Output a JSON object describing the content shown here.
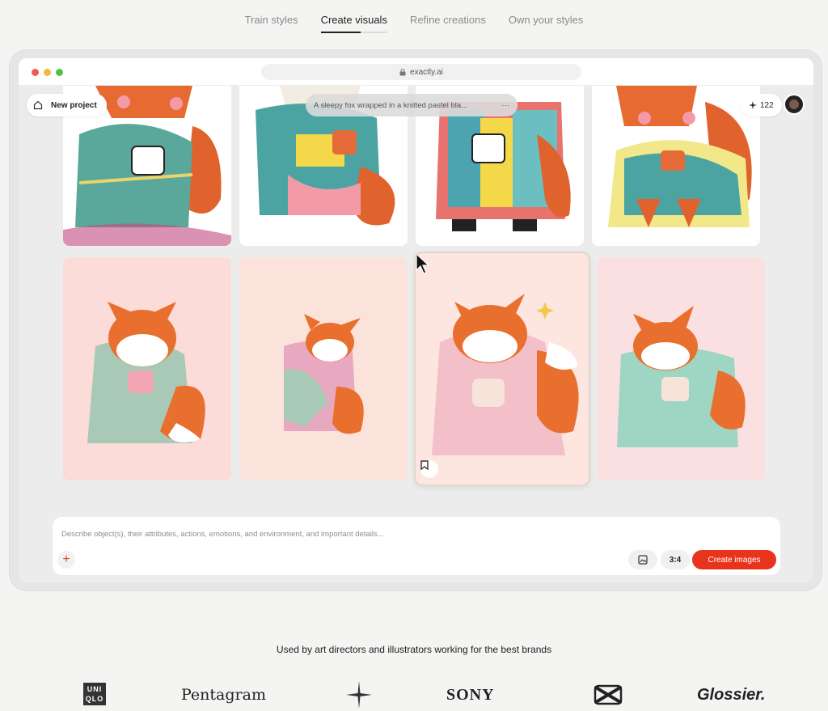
{
  "nav": {
    "tabs": [
      {
        "label": "Train styles"
      },
      {
        "label": "Create visuals",
        "active": true,
        "progress": 0.6
      },
      {
        "label": "Refine creations"
      },
      {
        "label": "Own your styles"
      }
    ]
  },
  "browser": {
    "url": "exactly.ai",
    "traffic_lights": [
      "#ee5d50",
      "#f4b93c",
      "#4fc24b"
    ]
  },
  "app": {
    "project_label": "New project",
    "prompt_preview": "A sleepy fox wrapped in a knitted pastel bla...",
    "more_label": "···",
    "credits": "122",
    "composer_placeholder": "Describe object(s), their attributes, actions, emotions, and environment, and important details...",
    "plus_label": "+",
    "aspect_ratio": "3:4",
    "create_label": "Create images"
  },
  "images": {
    "row1_bg": [
      "#ffffff",
      "#ffffff",
      "#ffffff",
      "#ffffff"
    ],
    "row2_bg": [
      "#fbdcd8",
      "#fbe3dc",
      "#fce6df",
      "#fbe0e2"
    ],
    "row2_blanket": [
      "#a8c9b6",
      "#e8a9c0",
      "#f3bfc8",
      "#9ed6c3"
    ]
  },
  "brands": {
    "caption": "Used by art directors and illustrators working for the best brands",
    "uniqlo_line1": "UNI",
    "uniqlo_line2": "QLO",
    "pentagram": "Pentagram",
    "sony": "SONY",
    "glossier": "Glossier."
  },
  "colors": {
    "accent": "#e8341c",
    "fox_orange": "#e96f2f"
  }
}
